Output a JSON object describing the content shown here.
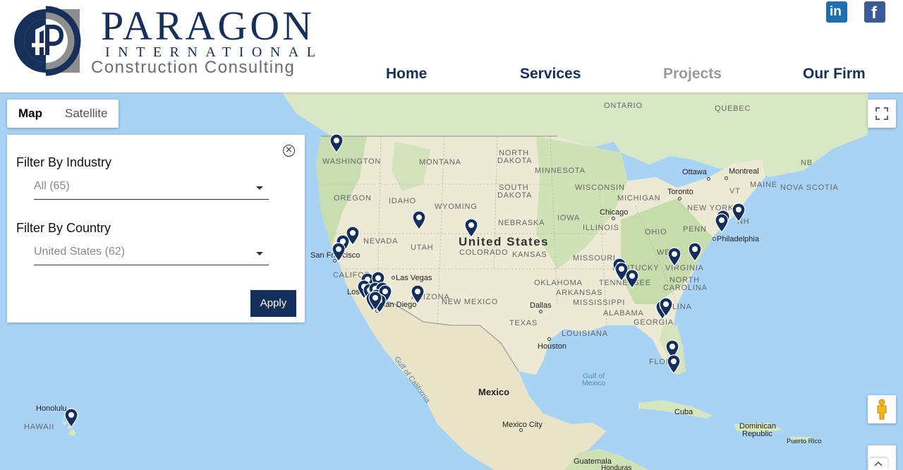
{
  "logo": {
    "wordmark": "PARAGON",
    "tagline_1": "INTERNATIONAL",
    "tagline_2": "Construction Consulting"
  },
  "nav": {
    "items": [
      {
        "label": "Home",
        "active": false
      },
      {
        "label": "Services",
        "active": false
      },
      {
        "label": "Projects",
        "active": true
      },
      {
        "label": "Our Firm",
        "active": false
      }
    ]
  },
  "social": {
    "linkedin_icon": "linkedin-icon",
    "facebook_icon": "facebook-icon"
  },
  "map": {
    "type_controls": {
      "map_label": "Map",
      "satellite_label": "Satellite",
      "selected": "Map"
    },
    "labels": {
      "ontario": "ONTARIO",
      "quebec": "QUEBEC",
      "nb": "NB",
      "nova_scotia": "NOVA SCOTIA",
      "washington": "WASHINGTON",
      "montana": "MONTANA",
      "north_dakota_1": "NORTH",
      "north_dakota_2": "DAKOTA",
      "south_dakota_1": "SOUTH",
      "south_dakota_2": "DAKOTA",
      "minnesota": "MINNESOTA",
      "wisconsin": "WISCONSIN",
      "michigan": "MICHIGAN",
      "oregon": "OREGON",
      "idaho": "IDAHO",
      "wyoming": "WYOMING",
      "nebraska": "NEBRASKA",
      "iowa": "IOWA",
      "illinois": "ILLINOIS",
      "ohio": "OHIO",
      "penn": "PENN",
      "new_york": "NEW YORK",
      "vt": "VT",
      "maine": "MAINE",
      "nh": "NH",
      "nevada": "NEVADA",
      "utah": "UTAH",
      "colorado": "COLORADO",
      "kansas": "KANSAS",
      "missouri": "MISSOURI",
      "kentucky": "KENTUCKY",
      "virginia": "VIRGINIA",
      "west_virginia": "WE",
      "california": "CALIFOR",
      "arizona": "ARIZONA",
      "new_mexico": "NEW MEXICO",
      "oklahoma": "OKLAHOMA",
      "tennessee": "TENNESSEE",
      "north_carolina_1": "NORTH",
      "north_carolina_2": "CAROLINA",
      "south_carolina": "LINA",
      "arkansas": "ARKANSAS",
      "mississippi": "MISSISSIPPI",
      "alabama": "ALABAMA",
      "georgia": "GEORGIA",
      "texas": "TEXAS",
      "louisiana": "LOUISIANA",
      "florida": "FLOR",
      "hawaii": "HAWAII",
      "ottawa": "Ottawa",
      "montreal": "Montreal",
      "toronto": "Toronto",
      "chicago": "Chicago",
      "philadelphia": "Philadelphia",
      "san_francisco": "San Francisco",
      "las_vegas": "Las Vegas",
      "los_angeles": "Los",
      "san_diego": "San Diego",
      "dallas": "Dallas",
      "houston": "Houston",
      "honolulu": "Honolulu",
      "mexico_city": "Mexico City",
      "cuba": "Cuba",
      "dominican_1": "Dominican",
      "dominican_2": "Republic",
      "puerto_rico": "Puerto Rico",
      "guatemala": "Guatemala",
      "honduras": "Honduras",
      "united_states": "United States",
      "mexico": "Mexico",
      "gulf_mexico_1": "Gulf of",
      "gulf_mexico_2": "Mexico",
      "gulf_california": "Gulf of California"
    },
    "pin_count": 38
  },
  "filter": {
    "industry_label": "Filter By Industry",
    "industry_value": "All (65)",
    "country_label": "Filter By Country",
    "country_value": "United States (62)",
    "apply_label": "Apply"
  },
  "colors": {
    "brand_navy": "#142f5c",
    "nav_active": "#9a9a9a",
    "map_water": "#a9d3f5",
    "map_land": "#e8e4d0"
  }
}
